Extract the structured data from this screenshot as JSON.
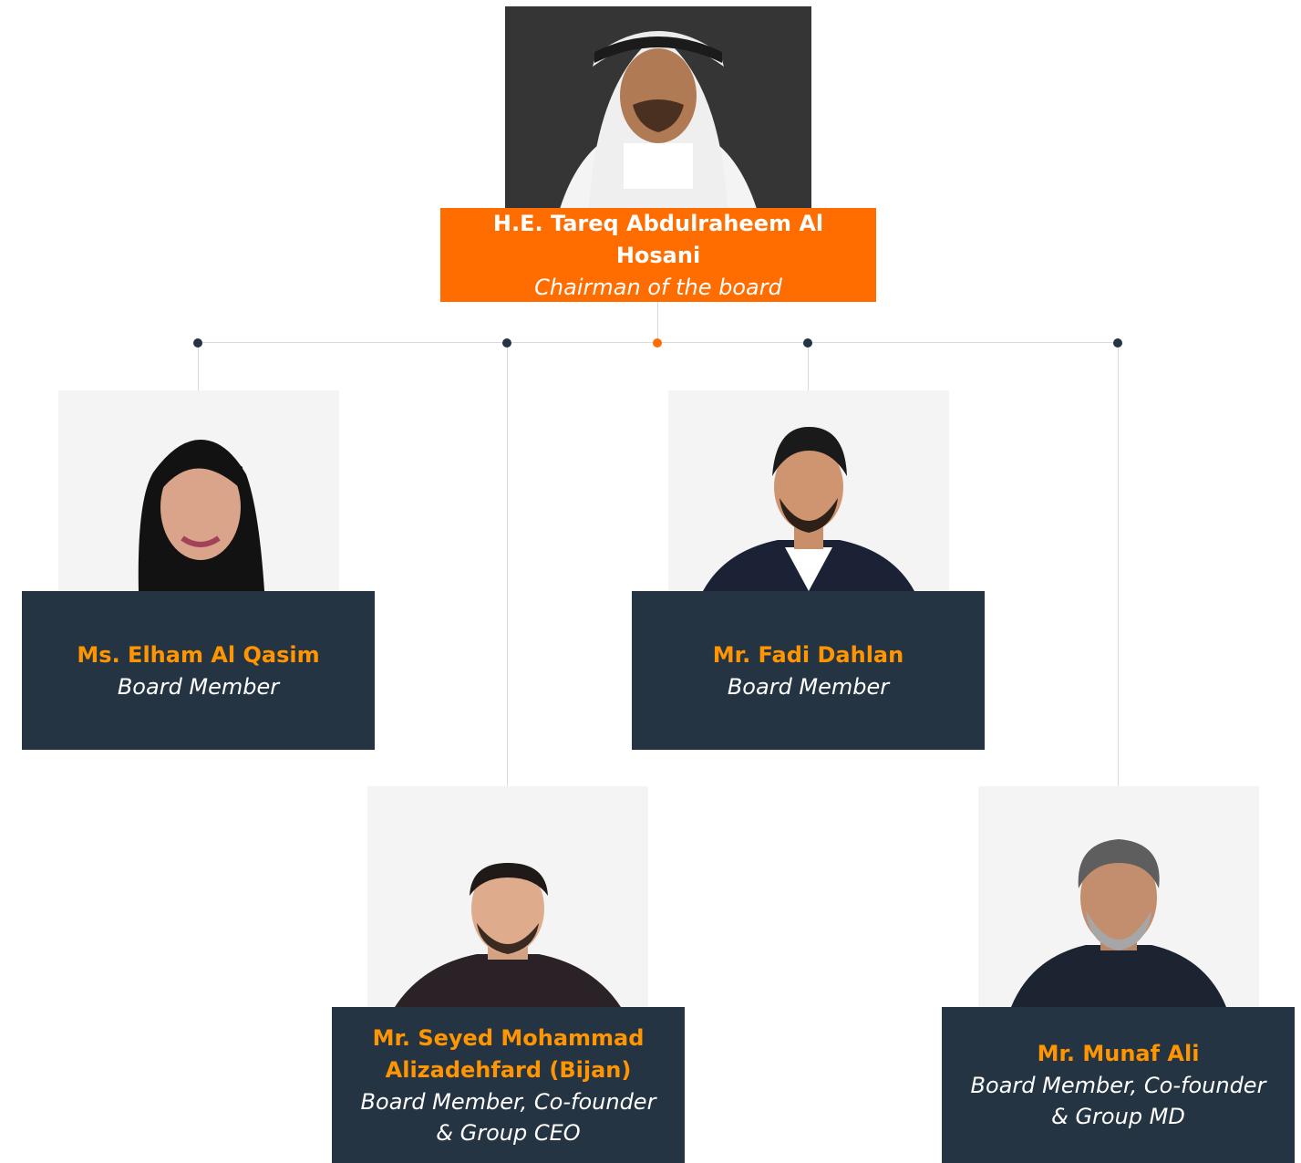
{
  "chairman": {
    "name": "H.E. Tareq Abdulraheem Al Hosani",
    "role": "Chairman of the board",
    "photo": "chairman-portrait"
  },
  "members": [
    {
      "name": "Ms. Elham Al Qasim",
      "role": "Board Member",
      "photo": "woman-hijab-portrait"
    },
    {
      "name": "Mr. Fadi Dahlan",
      "role": "Board Member",
      "photo": "man-blazer-portrait"
    },
    {
      "name": "Mr. Seyed Mohammad Alizadehfard (Bijan)",
      "role": "Board Member, Co-founder & Group CEO",
      "photo": "man-dark-shirt-portrait"
    },
    {
      "name": "Mr. Munaf Ali",
      "role": "Board Member, Co-founder & Group MD",
      "photo": "man-grey-beard-portrait"
    }
  ],
  "colors": {
    "accent": "#ff6c00",
    "navy": "#243442",
    "name_highlight": "#ff9500",
    "connector": "#d6dbe0"
  }
}
